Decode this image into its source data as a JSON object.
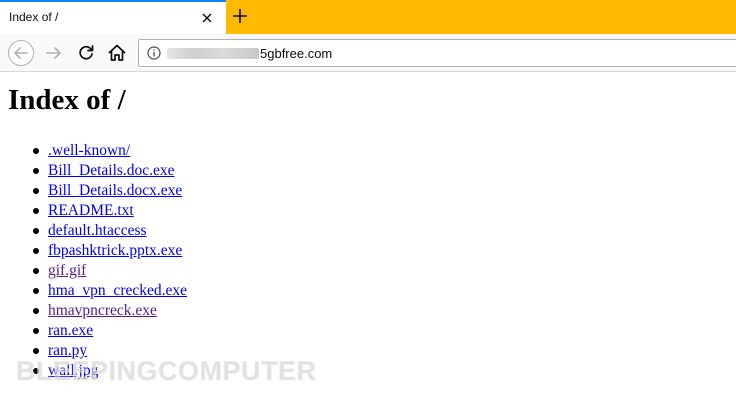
{
  "browser": {
    "tab": {
      "title": "Index of /"
    },
    "address_bar": {
      "url_visible": "5gbfree.com"
    },
    "icons": {
      "tab_close": "close-icon",
      "new_tab": "plus-icon",
      "back": "back-arrow-icon",
      "forward": "forward-arrow-icon",
      "reload": "reload-icon",
      "home": "home-icon",
      "site_info": "info-icon"
    }
  },
  "page": {
    "heading": "Index of /",
    "files": [
      {
        "name": ".well-known/",
        "visited": false
      },
      {
        "name": "Bill_Details.doc.exe",
        "visited": false
      },
      {
        "name": "Bill_Details.docx.exe",
        "visited": false
      },
      {
        "name": "README.txt",
        "visited": false
      },
      {
        "name": "default.htaccess",
        "visited": false
      },
      {
        "name": "fbpashktrick.pptx.exe",
        "visited": false
      },
      {
        "name": "gif.gif",
        "visited": true
      },
      {
        "name": "hma_vpn_crecked.exe",
        "visited": false
      },
      {
        "name": "hmavpncreck.exe",
        "visited": true
      },
      {
        "name": "ran.exe",
        "visited": false
      },
      {
        "name": "ran.py",
        "visited": false
      },
      {
        "name": "wall.jpg",
        "visited": false
      }
    ]
  },
  "watermark": "BLEEPINGCOMPUTER",
  "colors": {
    "tabstrip": "#ffbb00",
    "link": "#0000ee",
    "visited_link": "#551a8b",
    "active_tab_accent": "#0a84ff"
  }
}
